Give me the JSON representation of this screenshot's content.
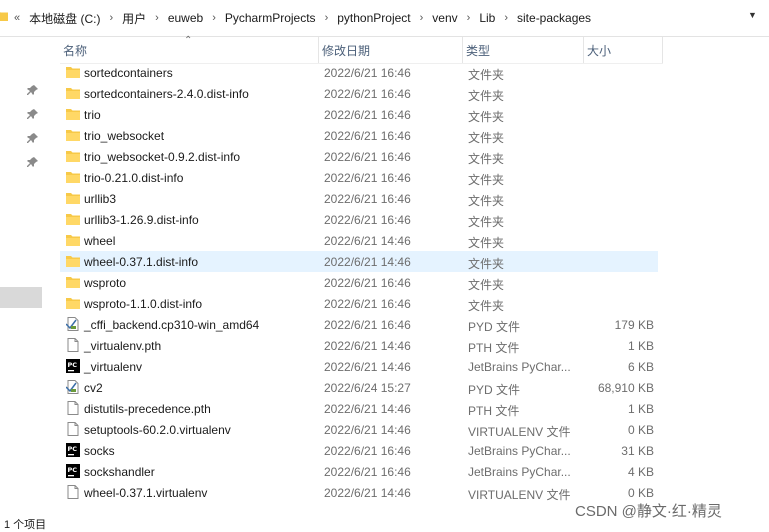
{
  "address": {
    "more": "«",
    "crumbs": [
      "本地磁盘 (C:)",
      "用户",
      "euweb",
      "PycharmProjects",
      "pythonProject",
      "venv",
      "Lib",
      "site-packages"
    ]
  },
  "columns": {
    "name": "名称",
    "date": "修改日期",
    "type": "类型",
    "size": "大小"
  },
  "files": [
    {
      "name": "sortedcontainers",
      "date": "2022/6/21 16:46",
      "type": "文件夹",
      "size": "",
      "icon": "folder"
    },
    {
      "name": "sortedcontainers-2.4.0.dist-info",
      "date": "2022/6/21 16:46",
      "type": "文件夹",
      "size": "",
      "icon": "folder"
    },
    {
      "name": "trio",
      "date": "2022/6/21 16:46",
      "type": "文件夹",
      "size": "",
      "icon": "folder"
    },
    {
      "name": "trio_websocket",
      "date": "2022/6/21 16:46",
      "type": "文件夹",
      "size": "",
      "icon": "folder"
    },
    {
      "name": "trio_websocket-0.9.2.dist-info",
      "date": "2022/6/21 16:46",
      "type": "文件夹",
      "size": "",
      "icon": "folder"
    },
    {
      "name": "trio-0.21.0.dist-info",
      "date": "2022/6/21 16:46",
      "type": "文件夹",
      "size": "",
      "icon": "folder"
    },
    {
      "name": "urllib3",
      "date": "2022/6/21 16:46",
      "type": "文件夹",
      "size": "",
      "icon": "folder"
    },
    {
      "name": "urllib3-1.26.9.dist-info",
      "date": "2022/6/21 16:46",
      "type": "文件夹",
      "size": "",
      "icon": "folder"
    },
    {
      "name": "wheel",
      "date": "2022/6/21 14:46",
      "type": "文件夹",
      "size": "",
      "icon": "folder"
    },
    {
      "name": "wheel-0.37.1.dist-info",
      "date": "2022/6/21 14:46",
      "type": "文件夹",
      "size": "",
      "icon": "folder"
    },
    {
      "name": "wsproto",
      "date": "2022/6/21 16:46",
      "type": "文件夹",
      "size": "",
      "icon": "folder"
    },
    {
      "name": "wsproto-1.1.0.dist-info",
      "date": "2022/6/21 16:46",
      "type": "文件夹",
      "size": "",
      "icon": "folder"
    },
    {
      "name": "_cffi_backend.cp310-win_amd64",
      "date": "2022/6/21 16:46",
      "type": "PYD 文件",
      "size": "179 KB",
      "icon": "pyd"
    },
    {
      "name": "_virtualenv.pth",
      "date": "2022/6/21 14:46",
      "type": "PTH 文件",
      "size": "1 KB",
      "icon": "doc"
    },
    {
      "name": "_virtualenv",
      "date": "2022/6/21 14:46",
      "type": "JetBrains PyChar...",
      "size": "6 KB",
      "icon": "pycharm"
    },
    {
      "name": "cv2",
      "date": "2022/6/24 15:27",
      "type": "PYD 文件",
      "size": "68,910 KB",
      "icon": "pyd"
    },
    {
      "name": "distutils-precedence.pth",
      "date": "2022/6/21 14:46",
      "type": "PTH 文件",
      "size": "1 KB",
      "icon": "doc"
    },
    {
      "name": "setuptools-60.2.0.virtualenv",
      "date": "2022/6/21 14:46",
      "type": "VIRTUALENV 文件",
      "size": "0 KB",
      "icon": "doc"
    },
    {
      "name": "socks",
      "date": "2022/6/21 16:46",
      "type": "JetBrains PyChar...",
      "size": "31 KB",
      "icon": "pycharm"
    },
    {
      "name": "sockshandler",
      "date": "2022/6/21 16:46",
      "type": "JetBrains PyChar...",
      "size": "4 KB",
      "icon": "pycharm"
    },
    {
      "name": "wheel-0.37.1.virtualenv",
      "date": "2022/6/21 14:46",
      "type": "VIRTUALENV 文件",
      "size": "0 KB",
      "icon": "doc"
    }
  ],
  "selected_index": 9,
  "status": "1 个项目",
  "watermark": "CSDN @静文·红·精灵",
  "colors": {
    "folder": "#f7c948",
    "selection": "#e5f3ff",
    "header_text": "#4c607a"
  }
}
